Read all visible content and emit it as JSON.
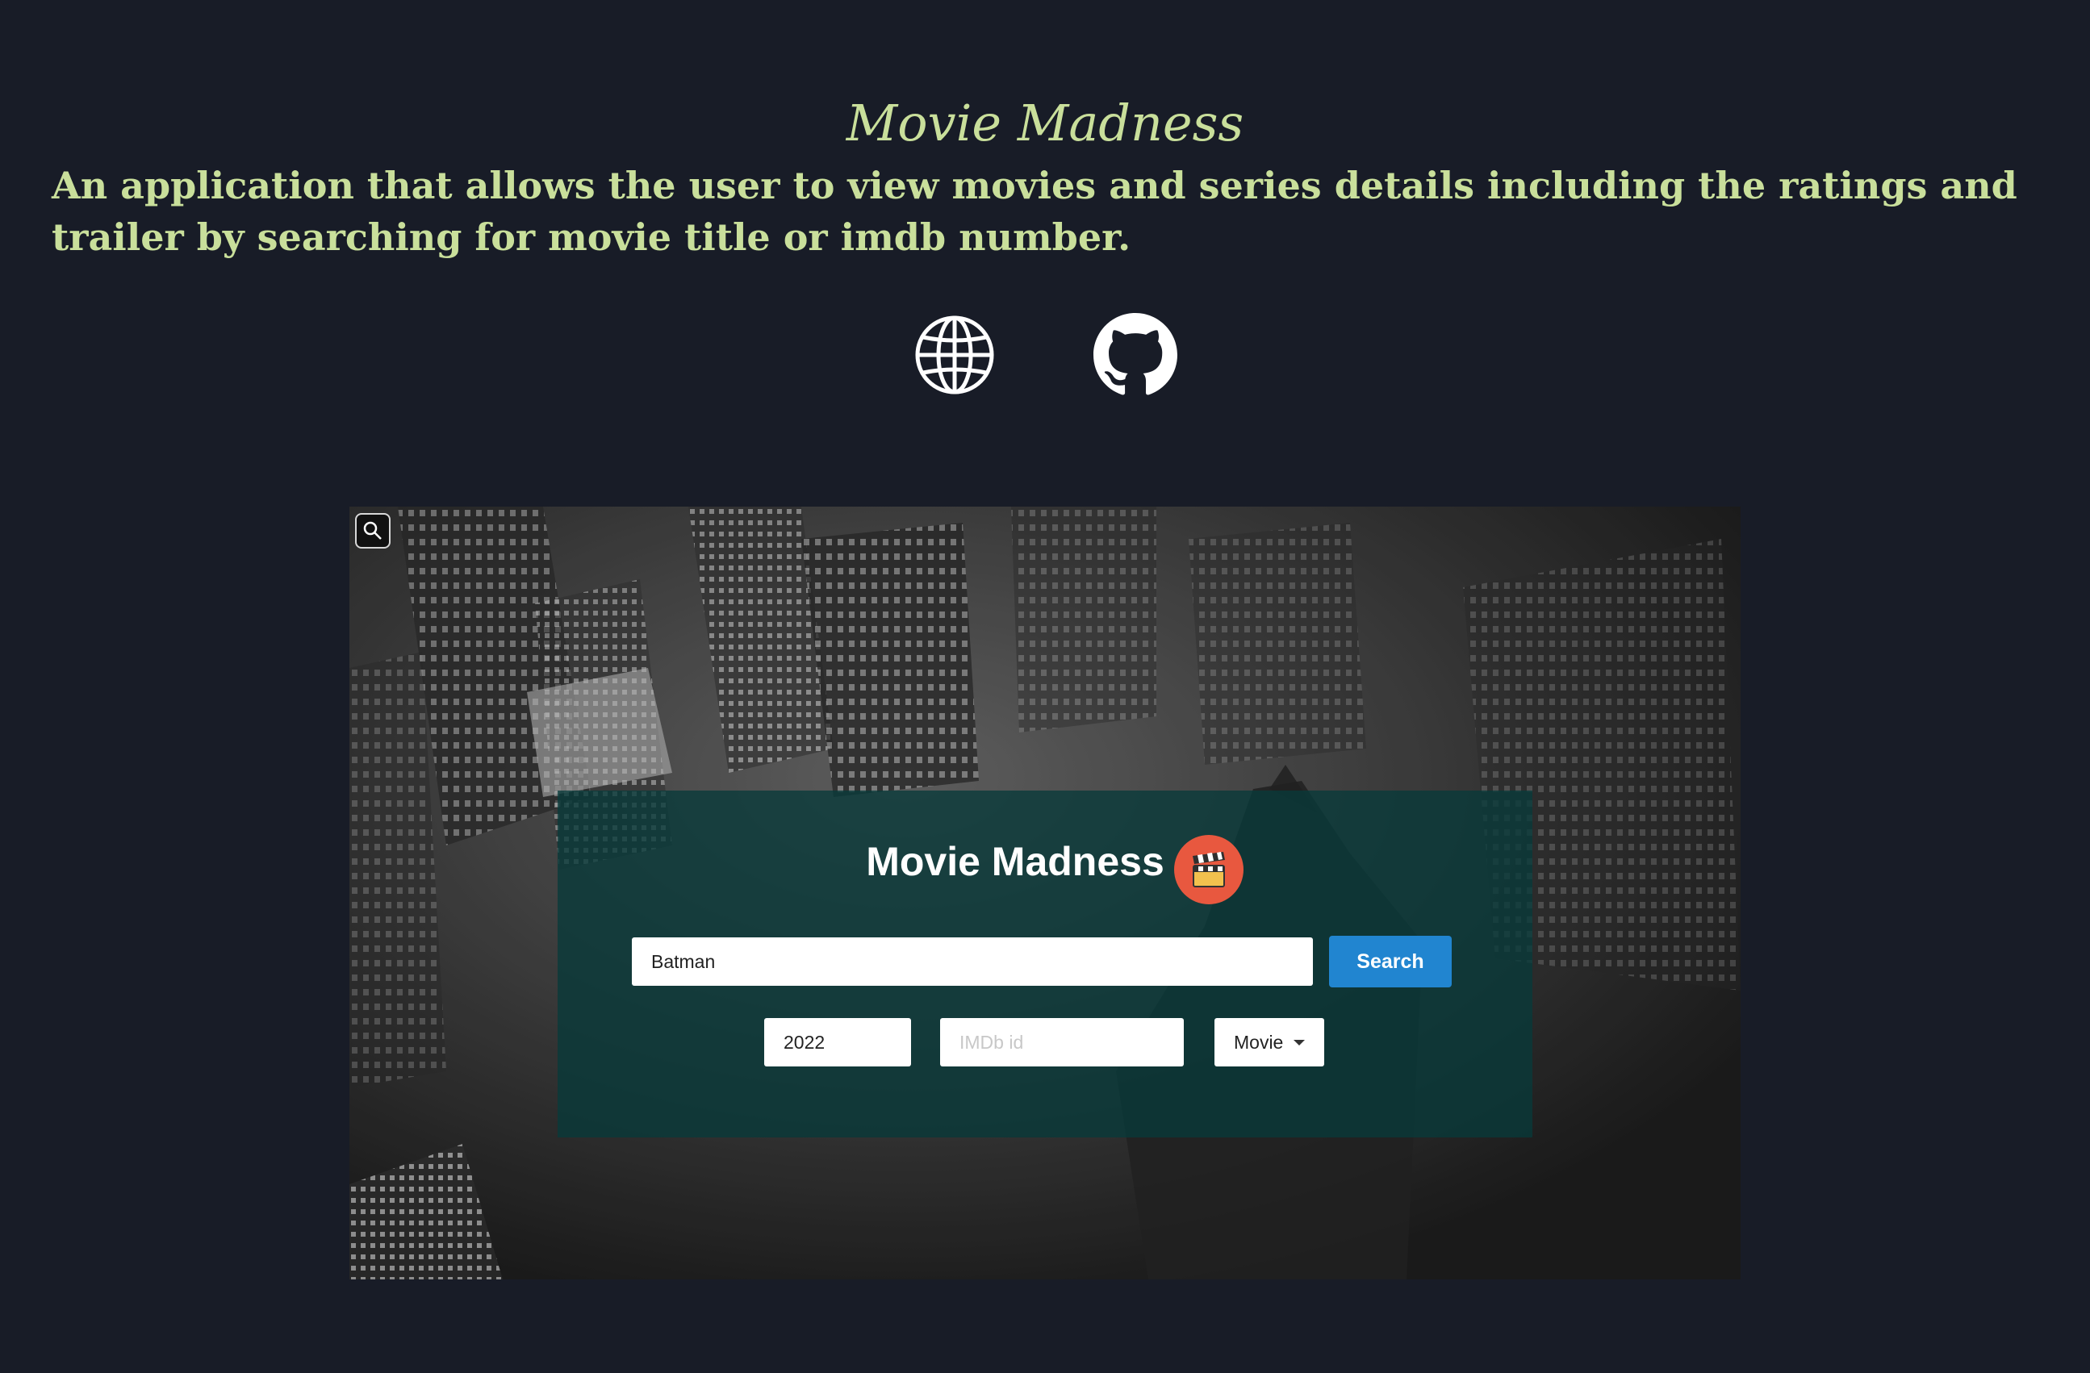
{
  "header": {
    "title": "Movie Madness",
    "description": "An application that allows the user to view movies and series details including the ratings and trailer by searching for movie title or imdb number."
  },
  "links": [
    {
      "icon": "globe-icon"
    },
    {
      "icon": "github-icon"
    }
  ],
  "preview": {
    "app_title": "Movie Madness",
    "logo_icon": "clapperboard-icon",
    "search_value": "Batman",
    "search_button": "Search",
    "year_value": "2022",
    "imdb_placeholder": "IMDb id",
    "type_selected": "Movie"
  },
  "colors": {
    "page_background": "#181c27",
    "heading_text": "#c9df9b",
    "card_background": "#083a3a",
    "search_button": "#2185d0",
    "logo_circle": "#e8583f"
  }
}
